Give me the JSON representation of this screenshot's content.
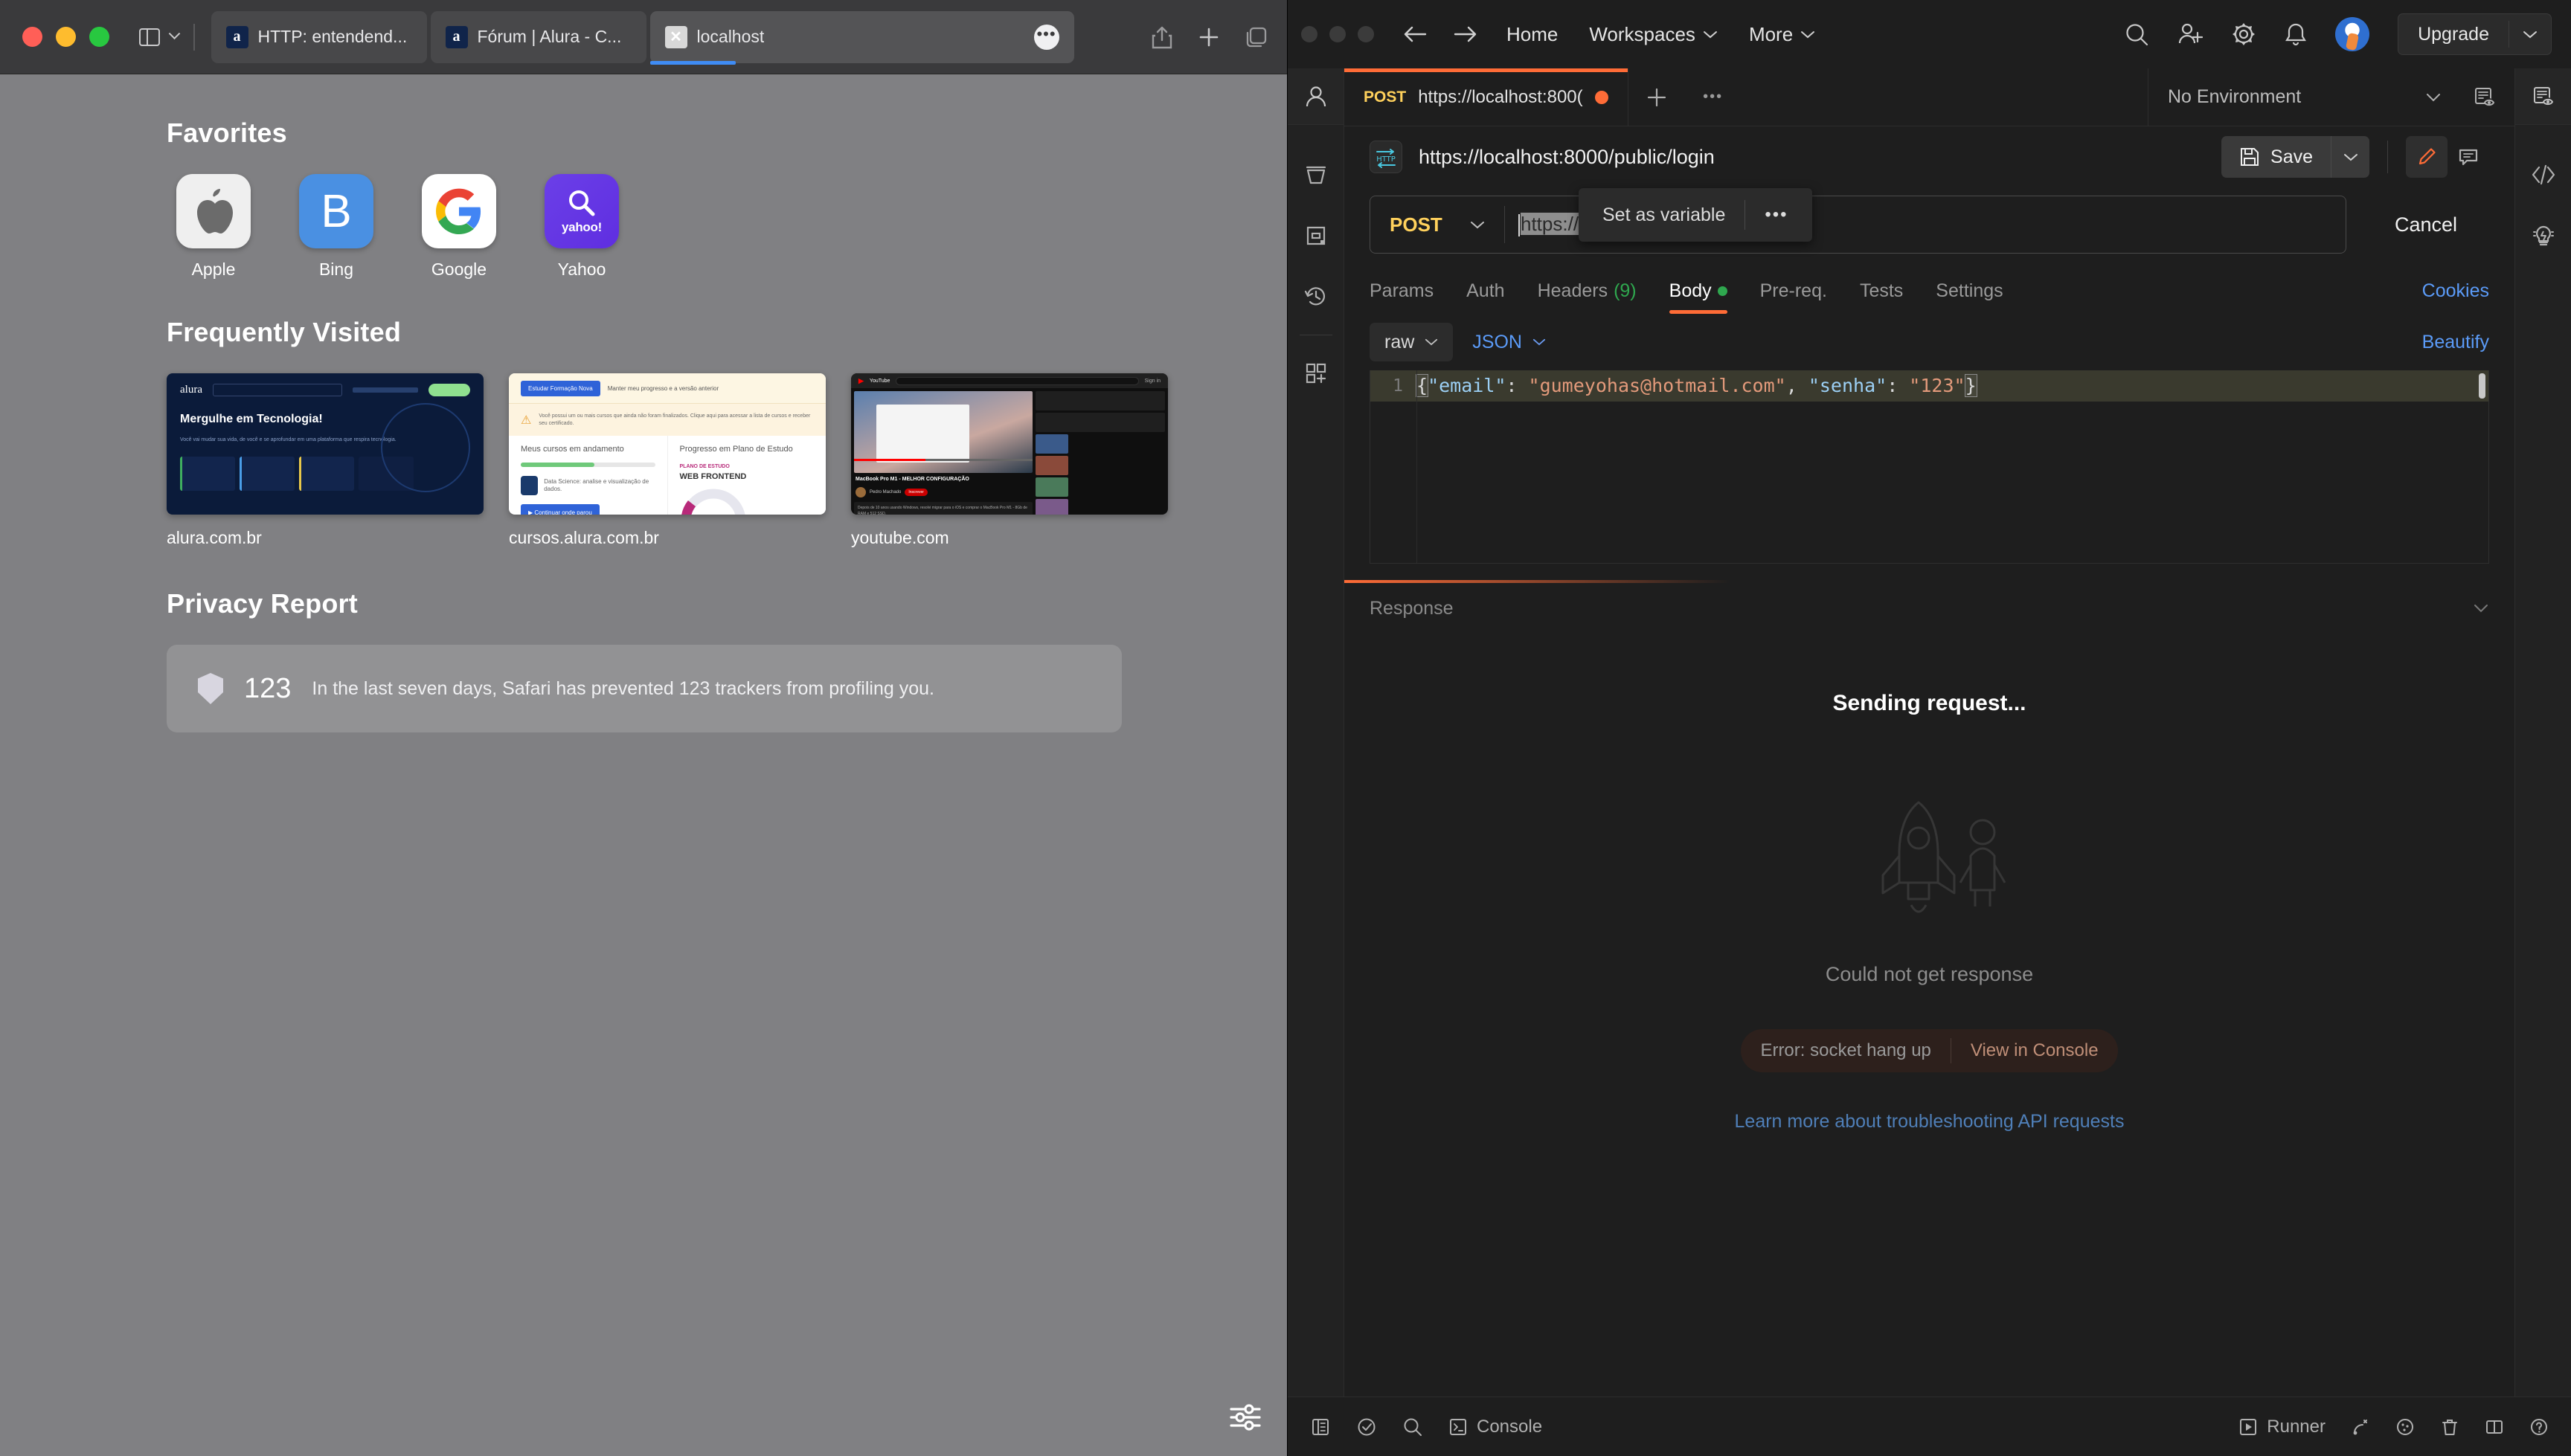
{
  "safari": {
    "window_controls": [
      "close",
      "minimize",
      "zoom"
    ],
    "tabs": [
      {
        "title": "HTTP: entendend...",
        "favicon": "alura-a-icon",
        "active": false
      },
      {
        "title": "Fórum | Alura - C...",
        "favicon": "alura-a-icon",
        "active": false
      },
      {
        "title": "localhost",
        "favicon": "broken-page-icon",
        "active": true
      }
    ],
    "toolbar_icons": [
      "sidebar-icon",
      "chevron-down-icon",
      "share-icon",
      "new-tab-icon",
      "tab-overview-icon"
    ],
    "start_page": {
      "favorites": {
        "title": "Favorites",
        "items": [
          {
            "label": "Apple",
            "icon": "apple-logo-icon"
          },
          {
            "label": "Bing",
            "icon": "bing-logo-icon"
          },
          {
            "label": "Google",
            "icon": "google-logo-icon"
          },
          {
            "label": "Yahoo",
            "icon": "yahoo-logo-icon"
          }
        ]
      },
      "frequently_visited": {
        "title": "Frequently Visited",
        "items": [
          {
            "label": "alura.com.br",
            "thumb_heading": "Mergulhe em Tecnologia!",
            "thumb_brand": "alura"
          },
          {
            "label": "cursos.alura.com.br",
            "thumb_heading": "Meus cursos em andamento",
            "thumb_heading2": "Progresso em Plano de Estudo"
          },
          {
            "label": "youtube.com",
            "thumb_heading": "MacBook Pro M1 - MELHOR CONFIGURAÇÃO"
          }
        ]
      },
      "privacy_report": {
        "title": "Privacy Report",
        "count": "123",
        "text": "In the last seven days, Safari has prevented 123 trackers from profiling you.",
        "icon": "shield-icon"
      },
      "settings_icon": "sliders-icon"
    }
  },
  "postman": {
    "titlebar": {
      "back_icon": "arrow-left-icon",
      "forward_icon": "arrow-right-icon",
      "menu": [
        {
          "label": "Home",
          "caret": false
        },
        {
          "label": "Workspaces",
          "caret": true
        },
        {
          "label": "More",
          "caret": true
        }
      ],
      "actions": [
        "search-icon",
        "invite-user-icon",
        "gear-icon",
        "bell-icon"
      ],
      "avatar": "user-avatar",
      "upgrade_label": "Upgrade",
      "upgrade_caret": "chevron-down-icon"
    },
    "left_rail": [
      "profile-icon",
      "collections-icon",
      "environments-icon",
      "history-icon",
      "new-app-icon"
    ],
    "right_rail": [
      "documentation-icon",
      "code-snippet-icon",
      "info-lightbulb-icon"
    ],
    "request_tab": {
      "method": "POST",
      "name": "https://localhost:800(",
      "unsaved": true,
      "add_icon": "plus-icon",
      "more_icon": "ellipsis-icon"
    },
    "environment": {
      "selected": "No Environment",
      "caret": "chevron-down-icon",
      "eye_icon": "eye-environment-icon"
    },
    "request": {
      "protocol_badge": "HTTP",
      "title": "https://localhost:8000/public/login",
      "save_label": "Save",
      "save_icon": "floppy-disk-icon",
      "save_caret_icon": "chevron-down-icon",
      "edit_icon": "pencil-icon",
      "comment_icon": "comment-icon",
      "method": "POST",
      "method_caret": "chevron-down-icon",
      "url_selected": "https://localhost:8000/",
      "url_rest": "public/login",
      "cancel_label": "Cancel"
    },
    "tooltip": {
      "label": "Set as variable",
      "more": "•••"
    },
    "subtabs": [
      {
        "label": "Params",
        "active": false
      },
      {
        "label": "Auth",
        "active": false
      },
      {
        "label": "Headers",
        "count": "(9)",
        "active": false
      },
      {
        "label": "Body",
        "active": true,
        "dot": true
      },
      {
        "label": "Pre-req.",
        "active": false
      },
      {
        "label": "Tests",
        "active": false
      },
      {
        "label": "Settings",
        "active": false
      }
    ],
    "cookies_link": "Cookies",
    "body_bar": {
      "mode": "raw",
      "mode_caret": "chevron-down-icon",
      "format": "JSON",
      "format_caret": "chevron-down-icon",
      "beautify": "Beautify"
    },
    "editor": {
      "line_number": "1",
      "tokens": [
        {
          "t": "{",
          "c": "brace"
        },
        {
          "t": "\"email\"",
          "c": "key"
        },
        {
          "t": ": ",
          "c": "punc"
        },
        {
          "t": "\"gumeyohas@hotmail.com\"",
          "c": "str"
        },
        {
          "t": ", ",
          "c": "punc"
        },
        {
          "t": "\"senha\"",
          "c": "key"
        },
        {
          "t": ": ",
          "c": "punc"
        },
        {
          "t": "\"123\"",
          "c": "str"
        },
        {
          "t": "}",
          "c": "brace"
        }
      ],
      "raw_text": "{\"email\": \"gumeyohas@hotmail.com\", \"senha\": \"123\"}"
    },
    "response": {
      "header": "Response",
      "collapse_icon": "chevron-down-icon",
      "sending": "Sending request...",
      "illustration": "rocket-astronaut-icon",
      "could_not": "Could not get response",
      "error": "Error: socket hang up",
      "view_in_console": "View in Console",
      "learn_more": "Learn more about troubleshooting API requests"
    },
    "statusbar": {
      "left": [
        {
          "icon": "sidebar-toggle-icon",
          "label": ""
        },
        {
          "icon": "checkmark-circle-icon",
          "label": ""
        },
        {
          "icon": "search-icon",
          "label": ""
        },
        {
          "icon": "console-icon",
          "label": "Console"
        }
      ],
      "right": [
        {
          "icon": "runner-icon",
          "label": "Runner"
        },
        {
          "icon": "capture-requests-icon",
          "label": ""
        },
        {
          "icon": "cookies-icon",
          "label": ""
        },
        {
          "icon": "trash-icon",
          "label": ""
        },
        {
          "icon": "two-pane-icon",
          "label": ""
        },
        {
          "icon": "help-icon",
          "label": ""
        }
      ]
    }
  },
  "colors": {
    "postman_accent": "#ff6c37",
    "method_post": "#ffd15c",
    "link_blue": "#5b9bf8",
    "ok_green": "#2fa84f",
    "safari_tab_active_underline": "#3f8cf5"
  }
}
